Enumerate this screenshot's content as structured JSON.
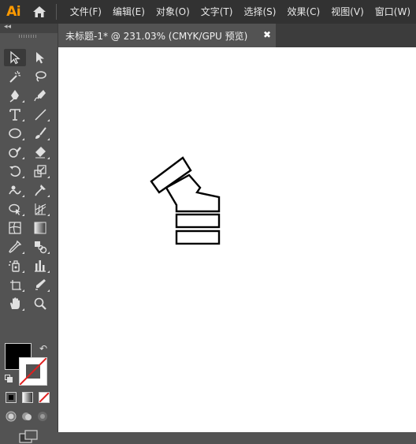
{
  "app": {
    "logo": "Ai"
  },
  "menus": [
    "文件(F)",
    "编辑(E)",
    "对象(O)",
    "文字(T)",
    "选择(S)",
    "效果(C)",
    "视图(V)",
    "窗口(W)"
  ],
  "document": {
    "tab_title": "未标题-1* @ 231.03% (CMYK/GPU 预览)",
    "close_glyph": "✖"
  },
  "toolbar": {
    "collapse_glyph": "◂◂",
    "swap_glyph": "↶"
  },
  "colors": {
    "fill": "#000000",
    "stroke": "#ffffff",
    "accent": "#ff9a00",
    "none_slash": "#e02020"
  },
  "tools": [
    {
      "name": "selection-tool-icon",
      "selected": true
    },
    {
      "name": "direct-selection-tool-icon"
    },
    {
      "name": "magic-wand-tool-icon"
    },
    {
      "name": "lasso-tool-icon"
    },
    {
      "name": "pen-tool-icon"
    },
    {
      "name": "curvature-tool-icon"
    },
    {
      "name": "type-tool-icon"
    },
    {
      "name": "line-segment-tool-icon"
    },
    {
      "name": "ellipse-tool-icon"
    },
    {
      "name": "paintbrush-tool-icon"
    },
    {
      "name": "shaper-tool-icon"
    },
    {
      "name": "eraser-tool-icon"
    },
    {
      "name": "rotate-tool-icon"
    },
    {
      "name": "scale-tool-icon"
    },
    {
      "name": "warp-tool-icon"
    },
    {
      "name": "puppet-warp-tool-icon"
    },
    {
      "name": "shape-builder-tool-icon"
    },
    {
      "name": "perspective-grid-tool-icon"
    },
    {
      "name": "mesh-tool-icon"
    },
    {
      "name": "gradient-tool-icon"
    },
    {
      "name": "eyedropper-tool-icon"
    },
    {
      "name": "blend-tool-icon"
    },
    {
      "name": "symbol-sprayer-tool-icon"
    },
    {
      "name": "column-graph-tool-icon"
    },
    {
      "name": "artboard-tool-icon"
    },
    {
      "name": "slice-tool-icon"
    },
    {
      "name": "hand-tool-icon"
    },
    {
      "name": "zoom-tool-icon"
    }
  ]
}
